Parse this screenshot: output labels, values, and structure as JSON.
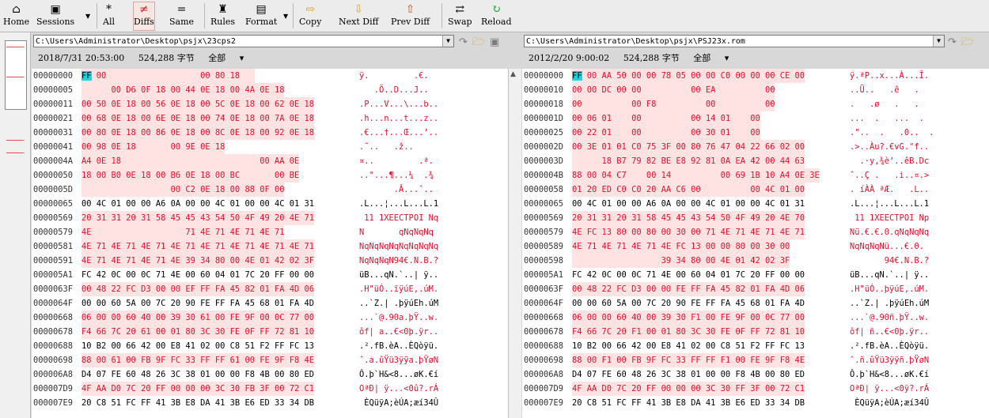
{
  "toolbar": {
    "buttons": [
      {
        "name": "home",
        "label": "Home",
        "icon": "home-icon",
        "glyph": "⌂"
      },
      {
        "name": "sessions",
        "label": "Sessions",
        "icon": "briefcase-icon",
        "glyph": "▣"
      },
      {
        "name": "all",
        "label": "All",
        "icon": "asterisk-icon",
        "glyph": "*"
      },
      {
        "name": "diffs",
        "label": "Diffs",
        "icon": "not-equal-icon",
        "glyph": "≠"
      },
      {
        "name": "same",
        "label": "Same",
        "icon": "equal-icon",
        "glyph": "="
      },
      {
        "name": "rules",
        "label": "Rules",
        "icon": "referee-icon",
        "glyph": "♜"
      },
      {
        "name": "format",
        "label": "Format",
        "icon": "format-icon",
        "glyph": "▤"
      },
      {
        "name": "copy",
        "label": "Copy",
        "icon": "arrow-right-icon",
        "glyph": "⇨"
      },
      {
        "name": "next-diff",
        "label": "Next Diff",
        "icon": "arrow-down-icon",
        "glyph": "⇩"
      },
      {
        "name": "prev-diff",
        "label": "Prev Diff",
        "icon": "arrow-up-icon",
        "glyph": "⇧"
      },
      {
        "name": "swap",
        "label": "Swap",
        "icon": "swap-icon",
        "glyph": "⇄"
      },
      {
        "name": "reload",
        "label": "Reload",
        "icon": "reload-icon",
        "glyph": "↻"
      }
    ]
  },
  "left": {
    "path": "C:\\Users\\Administrator\\Desktop\\psjx\\23cps2",
    "date": "2018/7/31 20:53:00",
    "size": "524,288 字节",
    "view": "全部",
    "rows": [
      {
        "addr": "00000000",
        "hex": "FF 00                   00 80 18   ",
        "asc": "ÿ.         .€."
      },
      {
        "addr": "00000005",
        "hex": "      00 D6 0F 18 00 44 0E 18 00 4A 0E 18",
        "asc": "   .Ö..D...J.."
      },
      {
        "addr": "00000011",
        "hex": "00 50 0E 18 00 56 0E 18 00 5C 0E 18 00 62 0E 18",
        "asc": ".P...V...\\...b.."
      },
      {
        "addr": "00000021",
        "hex": "00 68 0E 18 00 6E 0E 18 00 74 0E 18 00 7A 0E 18",
        "asc": ".h...n...t...z.."
      },
      {
        "addr": "00000031",
        "hex": "00 80 0E 18 00 86 0E 18 00 8C 0E 18 00 92 0E 18",
        "asc": ".€...†...Œ...’.."
      },
      {
        "addr": "00000041",
        "hex": "00 98 0E 18       00 9E 0E 18",
        "asc": ".˜..   .ž.."
      },
      {
        "addr": "0000004A",
        "hex": "A4 0E 18                            00 AA 0E",
        "asc": "¤..         .ª."
      },
      {
        "addr": "00000050",
        "hex": "18 00 B0 0E 18 00 B6 0E 18 00 BC       00 BE",
        "asc": "..°...¶...¼  .¾"
      },
      {
        "addr": "0000005D",
        "hex": "                  00 C2 0E 18 00 88 0F 00",
        "asc": "       .Â...ˆ.."
      },
      {
        "addr": "00000065",
        "hex": "00 4C 01 00 00 A6 0A 00 00 4C 01 00 00 4C 01 31",
        "asc": ".L...¦...L...L.1"
      },
      {
        "addr": "00000569",
        "hex": "20 31 31 20 31 58 45 45 43 54 50 4F 49 20 4E 71",
        "asc": " 11 1XEECTPOI Nq"
      },
      {
        "addr": "00000579",
        "hex": "4E                   71 4E 71 4E 71 4E 71",
        "asc": "N       qNqNqNq"
      },
      {
        "addr": "00000581",
        "hex": "4E 71 4E 71 4E 71 4E 71 4E 71 4E 71 4E 71 4E 71",
        "asc": "NqNqNqNqNqNqNqNq"
      },
      {
        "addr": "00000591",
        "hex": "4E 71 4E 71 4E 71 4E 39 34 80 00 4E 01 42 02 3F",
        "asc": "NqNqNqN94€.N.B.?"
      },
      {
        "addr": "000005A1",
        "hex": "FC 42 0C 00 0C 71 4E 00 60 04 01 7C 20 FF 00 00",
        "asc": "üB...qN.`..| ÿ.."
      },
      {
        "addr": "0000063F",
        "hex": "00 48 22 FC D3 00 00 EF FF FA 45 82 01 FA 4D 06",
        "asc": ".H\"üÓ..ïÿúE‚.úM."
      },
      {
        "addr": "0000064F",
        "hex": "00 00 60 5A 00 7C 20 90 FE FF FA 45 68 01 FA 4D",
        "asc": "..`Z.| .þÿúEh.úM"
      },
      {
        "addr": "00000668",
        "hex": "06 00 00 60 40 00 39 30 61 00 FE 9F 00 0C 77 00",
        "asc": "...`@.90a.þŸ..w."
      },
      {
        "addr": "00000678",
        "hex": "F4 66 7C 20 61 00 01 80 3C 30 FE 0F FF 72 81 10",
        "asc": "ôf| a..€<0þ.ÿr.."
      },
      {
        "addr": "00000688",
        "hex": "10 B2 00 66 42 00 E8 41 02 00 C8 51 F2 FF FC 13",
        "asc": ".².fB.èA..ÈQòÿü."
      },
      {
        "addr": "00000698",
        "hex": "88 00 61 00 FB 9F FC 33 FF FF 61 00 FE 9F F8 4E",
        "asc": "ˆ.a.ûŸü3ÿÿa.þŸøN"
      },
      {
        "addr": "000006A8",
        "hex": "D4 07 FE 60 48 26 3C 38 01 00 00 F8 4B 00 80 ED",
        "asc": "Ô.þ`H&<8...øK.€í"
      },
      {
        "addr": "000007D9",
        "hex": "4F AA D0 7C 20 FF 00 00 00 3C 30 FB 3F 00 72 C1",
        "asc": "OªÐ| ÿ...<0û?.rÁ"
      },
      {
        "addr": "000007E9",
        "hex": "20 C8 51 FC FF 41 3B E8 DA 41 3B E6 ED 33 34 DB",
        "asc": " ÈQüÿA;èÚA;æí34Û"
      }
    ]
  },
  "right": {
    "path": "C:\\Users\\Administrator\\Desktop\\psjx\\PSJ23x.rom",
    "date": "2012/2/20 9:00:02",
    "size": "524,288 字节",
    "view": "全部",
    "rows": [
      {
        "addr": "00000000",
        "hex": "FF 00 AA 50 00 00 78 05 00 00 C0 00 00 00 CE 00",
        "asc": "ÿ.ªP..x...À...Î."
      },
      {
        "addr": "00000010",
        "hex": "00 00 DC 00 00          00 EA          00",
        "asc": "..Ü..   .ê   ."
      },
      {
        "addr": "00000018",
        "hex": "00          00 F8          00          00",
        "asc": ".   .ø   .   ."
      },
      {
        "addr": "0000001D",
        "hex": "00 06 01    00          00 14 01    00",
        "asc": "...  .   ...  ."
      },
      {
        "addr": "00000025",
        "hex": "00 22 01    00          00 30 01    00",
        "asc": ".\"..  .   .0..  ."
      },
      {
        "addr": "0000002D",
        "hex": "00 3E 01 01 C0 75 3F 00 80 76 47 04 22 66 02 00",
        "asc": ".>..Àu?.€vG.\"f.."
      },
      {
        "addr": "0000003D",
        "hex": "      18 B7 79 82 BE E8 92 81 0A EA 42 00 44 63",
        "asc": "  .·y‚¾è’..êB.Dc"
      },
      {
        "addr": "0000004B",
        "hex": "88 00 04 C7    00 14          00 69 1B 10 A4 0E 3E",
        "asc": "ˆ..Ç .   .i..¤.>"
      },
      {
        "addr": "00000058",
        "hex": "01 20 ED C0 C0 20 AA C6 00          00 4C 01 00",
        "asc": ". íÀÀ ªÆ.   .L.."
      },
      {
        "addr": "00000065",
        "hex": "00 4C 01 00 00 A6 0A 00 00 4C 01 00 00 4C 01 31",
        "asc": ".L...¦...L...L.1"
      },
      {
        "addr": "00000569",
        "hex": "20 31 31 20 31 58 45 45 43 54 50 4F 49 20 4E 70",
        "asc": " 11 1XEECTPOI Np"
      },
      {
        "addr": "00000579",
        "hex": "4E FC 13 80 00 80 00 30 00 71 4E 71 4E 71 4E 71",
        "asc": "Nü.€.€.0.qNqNqNq"
      },
      {
        "addr": "00000589",
        "hex": "4E 71 4E 71 4E 71 4E FC 13 00 00 80 00 30 00",
        "asc": "NqNqNqNü...€.0."
      },
      {
        "addr": "00000598",
        "hex": "                  39 34 80 00 4E 01 42 02 3F",
        "asc": "       94€.N.B.?"
      },
      {
        "addr": "000005A1",
        "hex": "FC 42 0C 00 0C 71 4E 00 60 04 01 7C 20 FF 00 00",
        "asc": "üB...qN.`..| ÿ.."
      },
      {
        "addr": "0000063F",
        "hex": "00 48 22 FC D3 00 00 FE FF FA 45 82 01 FA 4D 06",
        "asc": ".H\"üÓ..þÿúE‚.úM."
      },
      {
        "addr": "0000064F",
        "hex": "00 00 60 5A 00 7C 20 90 FE FF FA 45 68 01 FA 4D",
        "asc": "..`Z.| .þÿúEh.úM"
      },
      {
        "addr": "00000668",
        "hex": "06 00 00 60 40 00 39 30 F1 00 FE 9F 00 0C 77 00",
        "asc": "...`@.90ñ.þŸ..w."
      },
      {
        "addr": "00000678",
        "hex": "F4 66 7C 20 F1 00 01 80 3C 30 FE 0F FF 72 81 10",
        "asc": "ôf| ñ..€<0þ.ÿr.."
      },
      {
        "addr": "00000688",
        "hex": "10 B2 00 66 42 00 E8 41 02 00 C8 51 F2 FF FC 13",
        "asc": ".².fB.èA..ÈQòÿü."
      },
      {
        "addr": "00000698",
        "hex": "88 00 F1 00 FB 9F FC 33 FF FF F1 00 FE 9F F8 4E",
        "asc": "ˆ.ñ.ûŸü3ÿÿñ.þŸøN"
      },
      {
        "addr": "000006A8",
        "hex": "D4 07 FE 60 48 26 3C 38 01 00 00 F8 4B 00 80 ED",
        "asc": "Ô.þ`H&<8...øK.€í"
      },
      {
        "addr": "000007D9",
        "hex": "4F AA D0 7C 20 FF 00 00 00 3C 30 FF 3F 00 72 C1",
        "asc": "OªÐ| ÿ...<0ÿ?.rÁ"
      },
      {
        "addr": "000007E9",
        "hex": "20 C8 51 FC FF 41 3B E8 DA 41 3B E6 ED 33 34 DB",
        "asc": " ÈQüÿA;èÚA;æí34Û"
      }
    ]
  },
  "colors": {
    "diff_text": "#e0102e",
    "diff_bg": "#ffe3e3",
    "cursor": "#19d5e0",
    "toolbar_bg": "#ececec"
  }
}
